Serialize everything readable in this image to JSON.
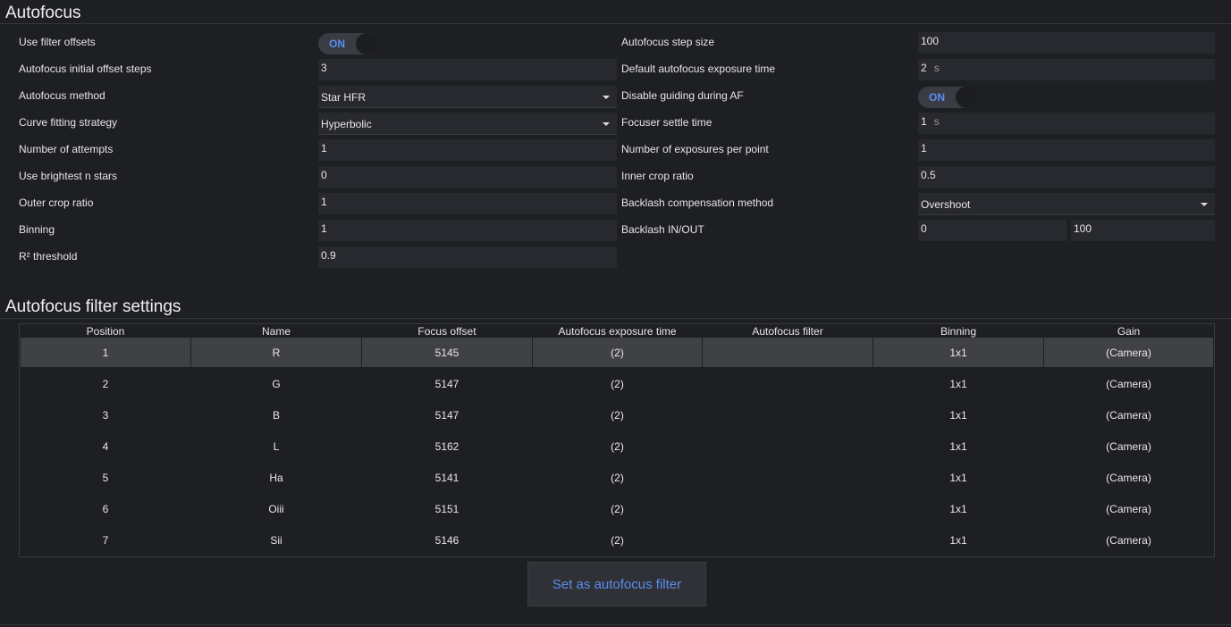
{
  "autofocus": {
    "title": "Autofocus",
    "left": [
      {
        "label": "Use filter offsets",
        "type": "toggle",
        "value": "ON"
      },
      {
        "label": "Autofocus initial offset steps",
        "type": "input",
        "value": "3"
      },
      {
        "label": "Autofocus method",
        "type": "select",
        "value": "Star HFR"
      },
      {
        "label": "Curve fitting strategy",
        "type": "select",
        "value": "Hyperbolic"
      },
      {
        "label": "Number of attempts",
        "type": "input",
        "value": "1"
      },
      {
        "label": "Use brightest n stars",
        "type": "input",
        "value": "0"
      },
      {
        "label": "Outer crop ratio",
        "type": "input",
        "value": "1"
      },
      {
        "label": "Binning",
        "type": "input",
        "value": "1"
      },
      {
        "label": "R² threshold",
        "type": "input",
        "value": "0.9"
      }
    ],
    "right": [
      {
        "label": "Autofocus step size",
        "type": "input",
        "value": "100"
      },
      {
        "label": "Default autofocus exposure time",
        "type": "input",
        "value": "2",
        "unit": "s"
      },
      {
        "label": "Disable guiding during AF",
        "type": "toggle",
        "value": "ON"
      },
      {
        "label": "Focuser settle time",
        "type": "input",
        "value": "1",
        "unit": "s"
      },
      {
        "label": "Number of exposures per point",
        "type": "input",
        "value": "1"
      },
      {
        "label": "Inner crop ratio",
        "type": "input",
        "value": "0.5"
      },
      {
        "label": "Backlash compensation method",
        "type": "select",
        "value": "Overshoot"
      },
      {
        "label": "Backlash IN/OUT",
        "type": "pair",
        "value": "0",
        "value2": "100"
      }
    ]
  },
  "filter_settings": {
    "title": "Autofocus filter settings",
    "columns": [
      "Position",
      "Name",
      "Focus offset",
      "Autofocus exposure time",
      "Autofocus filter",
      "Binning",
      "Gain"
    ],
    "rows": [
      {
        "position": "1",
        "name": "R",
        "offset": "5145",
        "exposure": "(2)",
        "af_filter": "",
        "binning": "1x1",
        "gain": "(Camera)",
        "selected": true
      },
      {
        "position": "2",
        "name": "G",
        "offset": "5147",
        "exposure": "(2)",
        "af_filter": "",
        "binning": "1x1",
        "gain": "(Camera)"
      },
      {
        "position": "3",
        "name": "B",
        "offset": "5147",
        "exposure": "(2)",
        "af_filter": "",
        "binning": "1x1",
        "gain": "(Camera)"
      },
      {
        "position": "4",
        "name": "L",
        "offset": "5162",
        "exposure": "(2)",
        "af_filter": "",
        "binning": "1x1",
        "gain": "(Camera)"
      },
      {
        "position": "5",
        "name": "Ha",
        "offset": "5141",
        "exposure": "(2)",
        "af_filter": "",
        "binning": "1x1",
        "gain": "(Camera)"
      },
      {
        "position": "6",
        "name": "Oiii",
        "offset": "5151",
        "exposure": "(2)",
        "af_filter": "",
        "binning": "1x1",
        "gain": "(Camera)"
      },
      {
        "position": "7",
        "name": "Sii",
        "offset": "5146",
        "exposure": "(2)",
        "af_filter": "",
        "binning": "1x1",
        "gain": "(Camera)"
      }
    ],
    "set_button": "Set as autofocus filter"
  }
}
